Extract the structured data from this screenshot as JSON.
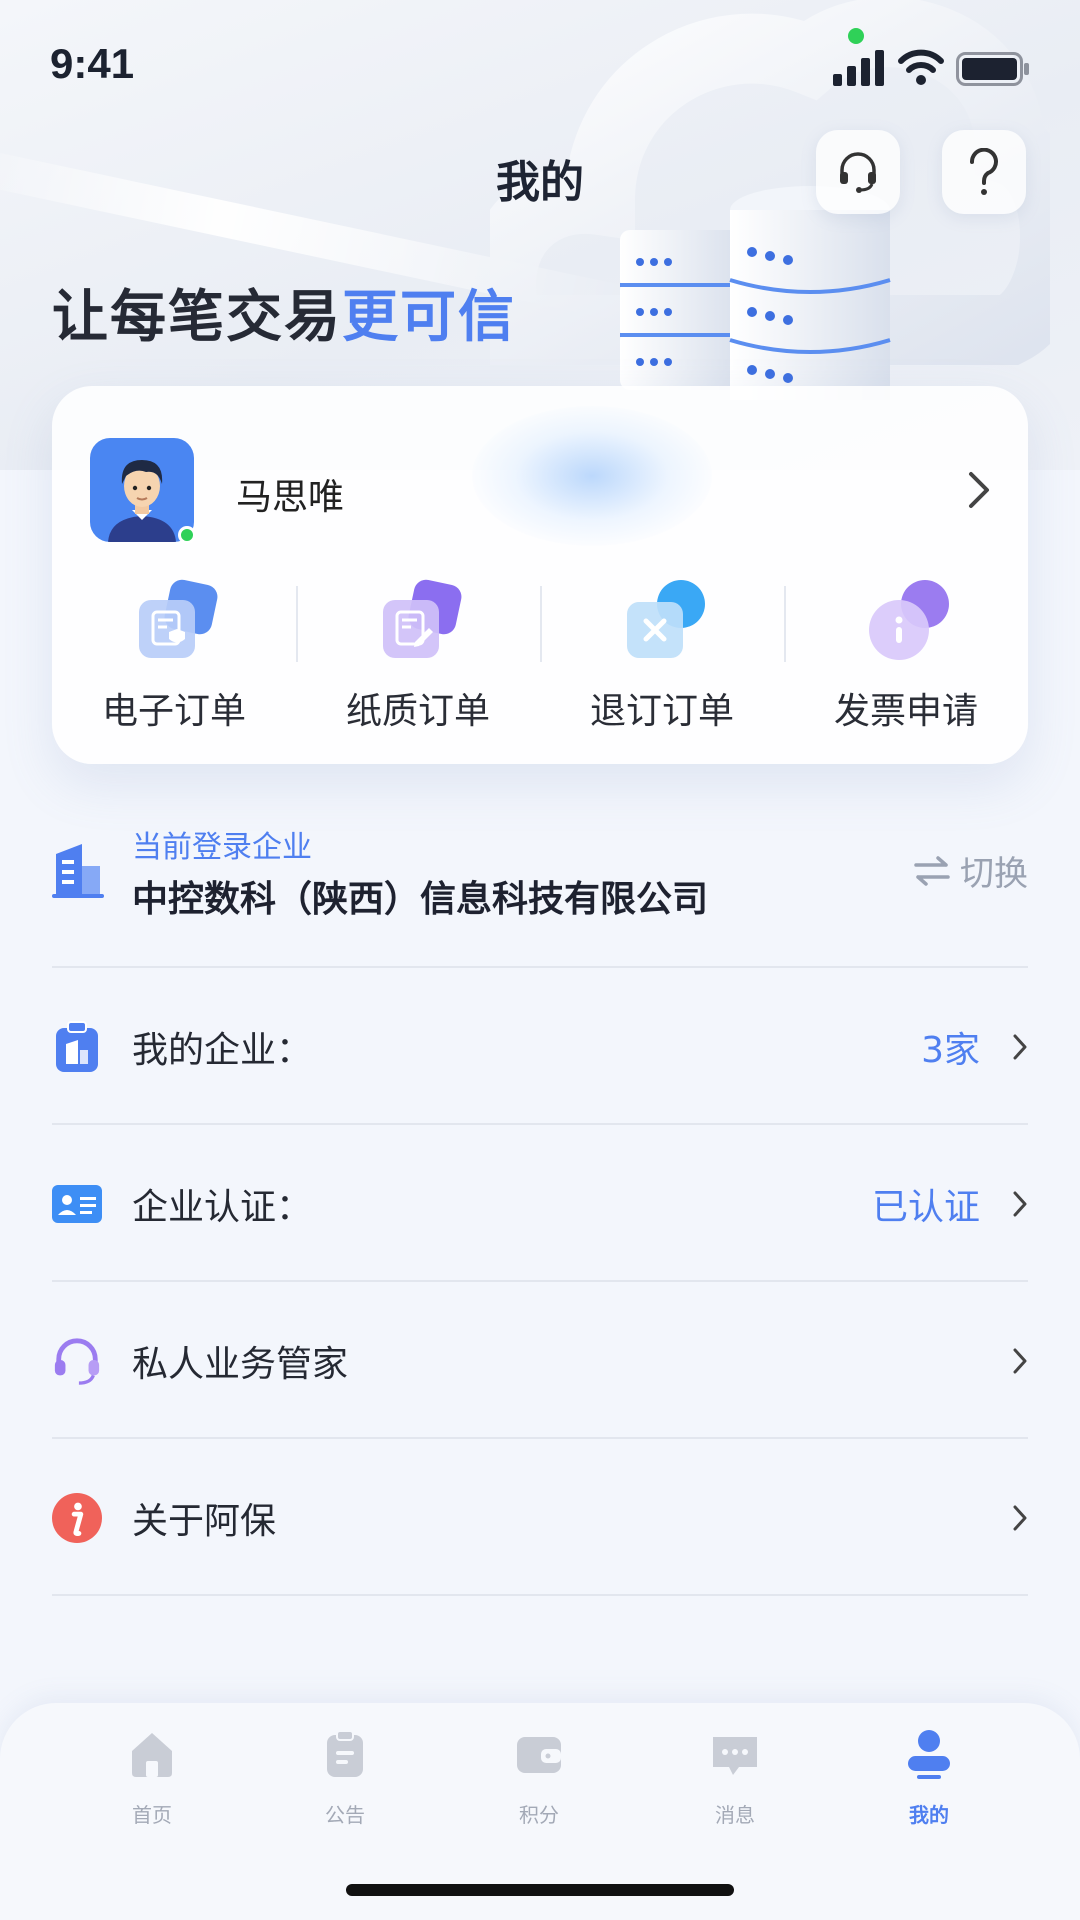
{
  "status_bar": {
    "time": "9:41"
  },
  "header": {
    "title": "我的",
    "support_icon": "headset-icon",
    "help_icon": "question-icon"
  },
  "slogan": {
    "main": "让每笔交易",
    "highlight": "更可信"
  },
  "profile": {
    "name": "马思唯",
    "avatar_icon": "user-avatar-icon",
    "online": true
  },
  "quick_actions": [
    {
      "label": "电子订单",
      "icon": "e-order-icon"
    },
    {
      "label": "纸质订单",
      "icon": "paper-order-icon"
    },
    {
      "label": "退订订单",
      "icon": "cancel-order-icon"
    },
    {
      "label": "发票申请",
      "icon": "invoice-icon"
    }
  ],
  "company": {
    "caption": "当前登录企业",
    "name": "中控数科（陕西）信息科技有限公司",
    "switch_label": "切换"
  },
  "menu": [
    {
      "label": "我的企业：",
      "value": "3家",
      "icon": "enterprise-icon"
    },
    {
      "label": "企业认证：",
      "value": "已认证",
      "icon": "id-card-icon"
    },
    {
      "label": "私人业务管家",
      "value": "",
      "icon": "headset-icon"
    },
    {
      "label": "关于阿保",
      "value": "",
      "icon": "info-icon"
    }
  ],
  "tabs": [
    {
      "label": "首页",
      "icon": "home-icon",
      "active": false
    },
    {
      "label": "公告",
      "icon": "clipboard-icon",
      "active": false
    },
    {
      "label": "积分",
      "icon": "wallet-icon",
      "active": false
    },
    {
      "label": "消息",
      "icon": "message-icon",
      "active": false
    },
    {
      "label": "我的",
      "icon": "profile-icon",
      "active": true
    }
  ],
  "colors": {
    "accent": "#4f7ff0",
    "online": "#2fd158",
    "info_red": "#f0625a",
    "purple": "#9b7cf0"
  }
}
